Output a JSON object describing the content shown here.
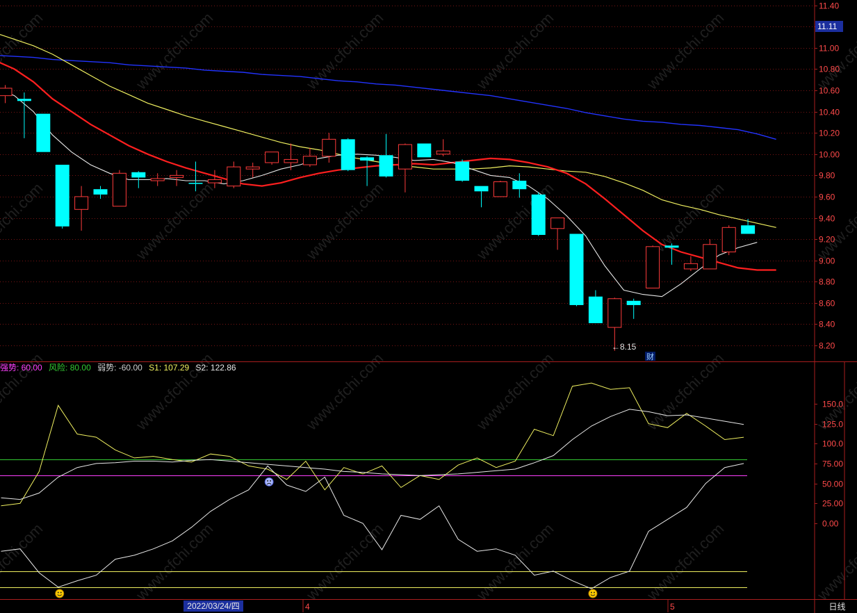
{
  "colors": {
    "up": "#ff3b3b",
    "down": "#00ffff",
    "ma_white": "#e8e8e8",
    "ma_red": "#ff1f1f",
    "ma_yellow": "#f0f060",
    "ma_blue": "#2233ff",
    "grid": "#7a1414",
    "axis_text": "#ff4a4a",
    "magenta": "#ff40ff",
    "green": "#33cc33"
  },
  "header": {
    "current_price": "11.11",
    "date_cursor": "2022/03/24/四",
    "month_marks": [
      "4",
      "5"
    ],
    "period": "日线",
    "low_annotation": "←8.15",
    "finance_marker": "财"
  },
  "legend": {
    "weak_label": "强势: 60.00",
    "risk_label": "风险: 80.00",
    "weak2_label": "弱势: -60.00",
    "s1_label": "S1: 107.29",
    "s2_label": "S2: 122.86"
  },
  "chart_data": [
    {
      "type": "candlestick",
      "y_ticks": [
        "11.40",
        "11.20",
        "11.00",
        "10.80",
        "10.60",
        "10.40",
        "10.20",
        "10.00",
        "9.80",
        "9.60",
        "9.40",
        "9.20",
        "9.00",
        "8.80",
        "8.60",
        "8.40",
        "8.20"
      ],
      "ylim": [
        8.05,
        11.45
      ],
      "candles": [
        {
          "o": 10.55,
          "h": 10.65,
          "l": 10.48,
          "c": 10.62
        },
        {
          "o": 10.52,
          "h": 10.58,
          "l": 10.15,
          "c": 10.5
        },
        {
          "o": 10.38,
          "h": 10.38,
          "l": 10.02,
          "c": 10.02
        },
        {
          "o": 9.9,
          "h": 9.9,
          "l": 9.3,
          "c": 9.32
        },
        {
          "o": 9.48,
          "h": 9.7,
          "l": 9.28,
          "c": 9.6
        },
        {
          "o": 9.67,
          "h": 9.7,
          "l": 9.58,
          "c": 9.62
        },
        {
          "o": 9.51,
          "h": 9.85,
          "l": 9.51,
          "c": 9.82
        },
        {
          "o": 9.83,
          "h": 9.84,
          "l": 9.68,
          "c": 9.78
        },
        {
          "o": 9.75,
          "h": 9.82,
          "l": 9.7,
          "c": 9.77
        },
        {
          "o": 9.78,
          "h": 9.85,
          "l": 9.7,
          "c": 9.8
        },
        {
          "o": 9.73,
          "h": 9.93,
          "l": 9.65,
          "c": 9.72
        },
        {
          "o": 9.73,
          "h": 9.85,
          "l": 9.68,
          "c": 9.76
        },
        {
          "o": 9.7,
          "h": 9.93,
          "l": 9.68,
          "c": 9.88
        },
        {
          "o": 9.86,
          "h": 9.92,
          "l": 9.78,
          "c": 9.88
        },
        {
          "o": 9.92,
          "h": 10.02,
          "l": 9.9,
          "c": 10.02
        },
        {
          "o": 9.92,
          "h": 10.1,
          "l": 9.85,
          "c": 9.95
        },
        {
          "o": 9.9,
          "h": 10.06,
          "l": 9.88,
          "c": 9.98
        },
        {
          "o": 9.98,
          "h": 10.2,
          "l": 9.92,
          "c": 10.14
        },
        {
          "o": 10.14,
          "h": 10.15,
          "l": 9.84,
          "c": 9.85
        },
        {
          "o": 9.97,
          "h": 9.98,
          "l": 9.7,
          "c": 9.94
        },
        {
          "o": 9.99,
          "h": 10.19,
          "l": 9.78,
          "c": 9.79
        },
        {
          "o": 9.86,
          "h": 10.1,
          "l": 9.64,
          "c": 10.09
        },
        {
          "o": 10.1,
          "h": 10.1,
          "l": 9.97,
          "c": 9.97
        },
        {
          "o": 10.0,
          "h": 10.14,
          "l": 9.98,
          "c": 10.03
        },
        {
          "o": 9.93,
          "h": 9.95,
          "l": 9.74,
          "c": 9.75
        },
        {
          "o": 9.7,
          "h": 9.7,
          "l": 9.5,
          "c": 9.65
        },
        {
          "o": 9.6,
          "h": 9.75,
          "l": 9.6,
          "c": 9.74
        },
        {
          "o": 9.75,
          "h": 9.82,
          "l": 9.59,
          "c": 9.67
        },
        {
          "o": 9.62,
          "h": 9.64,
          "l": 9.23,
          "c": 9.24
        },
        {
          "o": 9.3,
          "h": 9.38,
          "l": 9.1,
          "c": 9.4
        },
        {
          "o": 9.25,
          "h": 9.25,
          "l": 8.57,
          "c": 8.58
        },
        {
          "o": 8.66,
          "h": 8.72,
          "l": 8.41,
          "c": 8.41
        },
        {
          "o": 8.37,
          "h": 8.65,
          "l": 8.15,
          "c": 8.64
        },
        {
          "o": 8.62,
          "h": 8.64,
          "l": 8.45,
          "c": 8.58
        },
        {
          "o": 8.74,
          "h": 9.14,
          "l": 8.74,
          "c": 9.13
        },
        {
          "o": 9.14,
          "h": 9.16,
          "l": 8.96,
          "c": 9.12
        },
        {
          "o": 8.92,
          "h": 9.04,
          "l": 8.9,
          "c": 8.97
        },
        {
          "o": 8.92,
          "h": 9.2,
          "l": 8.92,
          "c": 9.15
        },
        {
          "o": 9.08,
          "h": 9.33,
          "l": 9.05,
          "c": 9.31
        },
        {
          "o": 9.33,
          "h": 9.39,
          "l": 9.25,
          "c": 9.25
        }
      ],
      "ma_white": [
        10.62,
        10.55,
        10.4,
        10.18,
        10.02,
        9.9,
        9.82,
        9.76,
        9.76,
        9.77,
        9.75,
        9.75,
        9.72,
        9.75,
        9.8,
        9.86,
        9.9,
        9.96,
        9.99,
        10.0,
        9.99,
        9.97,
        9.94,
        9.95,
        9.92,
        9.86,
        9.8,
        9.78,
        9.7,
        9.58,
        9.42,
        9.23,
        8.95,
        8.72,
        8.68,
        8.66,
        8.78,
        8.92,
        9.05,
        9.12,
        9.17
      ],
      "ma_red": [
        10.88,
        10.8,
        10.68,
        10.52,
        10.4,
        10.28,
        10.18,
        10.08,
        10.0,
        9.93,
        9.87,
        9.82,
        9.77,
        9.72,
        9.7,
        9.73,
        9.78,
        9.82,
        9.85,
        9.87,
        9.89,
        9.9,
        9.91,
        9.9,
        9.92,
        9.94,
        9.96,
        9.95,
        9.92,
        9.88,
        9.82,
        9.72,
        9.58,
        9.43,
        9.28,
        9.15,
        9.08,
        9.03,
        8.98,
        8.93,
        8.91,
        8.91
      ],
      "ma_yellow": [
        11.14,
        11.08,
        11.02,
        10.94,
        10.84,
        10.74,
        10.64,
        10.56,
        10.48,
        10.42,
        10.36,
        10.31,
        10.26,
        10.21,
        10.16,
        10.11,
        10.07,
        10.04,
        10.0,
        9.96,
        9.93,
        9.9,
        9.88,
        9.86,
        9.86,
        9.86,
        9.87,
        9.89,
        9.88,
        9.86,
        9.84,
        9.83,
        9.79,
        9.73,
        9.66,
        9.57,
        9.52,
        9.48,
        9.43,
        9.39,
        9.35,
        9.31
      ],
      "ma_blue": [
        10.93,
        10.92,
        10.91,
        10.89,
        10.88,
        10.87,
        10.86,
        10.84,
        10.83,
        10.82,
        10.81,
        10.79,
        10.78,
        10.77,
        10.75,
        10.74,
        10.73,
        10.71,
        10.69,
        10.68,
        10.66,
        10.65,
        10.63,
        10.61,
        10.59,
        10.57,
        10.55,
        10.52,
        10.49,
        10.46,
        10.43,
        10.39,
        10.36,
        10.33,
        10.31,
        10.3,
        10.28,
        10.27,
        10.25,
        10.23,
        10.19,
        10.14
      ]
    },
    {
      "type": "line",
      "y_ticks": [
        "150.0",
        "125.0",
        "100.0",
        "75.00",
        "50.00",
        "25.00",
        "0.00"
      ],
      "ylim": [
        -95,
        190
      ],
      "hlines": [
        {
          "value": 80,
          "color": "#33cc33"
        },
        {
          "value": 60,
          "color": "#ff40ff"
        },
        {
          "value": -60,
          "color": "#f0f060"
        },
        {
          "value": -80,
          "color": "#f0f060"
        }
      ],
      "series": [
        {
          "values": [
            22,
            25,
            65,
            148,
            112,
            108,
            92,
            82,
            84,
            80,
            77,
            87,
            84,
            72,
            68,
            55,
            78,
            42,
            70,
            62,
            72,
            45,
            60,
            55,
            73,
            82,
            70,
            78,
            118,
            110,
            172,
            176,
            168,
            170,
            125,
            120,
            138,
            122,
            105,
            108
          ]
        },
        {
          "values": [
            32,
            30,
            38,
            58,
            70,
            75,
            76,
            78,
            78,
            77,
            79,
            80,
            78,
            76,
            74,
            72,
            70,
            68,
            65,
            64,
            62,
            61,
            60,
            61,
            62,
            64,
            66,
            68,
            76,
            85,
            105,
            122,
            134,
            143,
            140,
            135,
            136,
            132,
            128,
            124
          ]
        },
        {
          "values": [
            -35,
            -32,
            -62,
            -80,
            -72,
            -65,
            -45,
            -40,
            -32,
            -22,
            -5,
            15,
            30,
            42,
            72,
            48,
            40,
            58,
            10,
            0,
            -33,
            10,
            5,
            22,
            -20,
            -35,
            -32,
            -40,
            -65,
            -60,
            -72,
            -82,
            -68,
            -60,
            -10,
            5,
            20,
            50,
            70,
            75
          ]
        }
      ],
      "markers": [
        {
          "x": 3,
          "y": -88,
          "icon": "smile-icon"
        },
        {
          "x": 14,
          "y": 52,
          "icon": "sad-icon"
        },
        {
          "x": 31,
          "y": -88,
          "icon": "smile-icon"
        }
      ]
    }
  ]
}
